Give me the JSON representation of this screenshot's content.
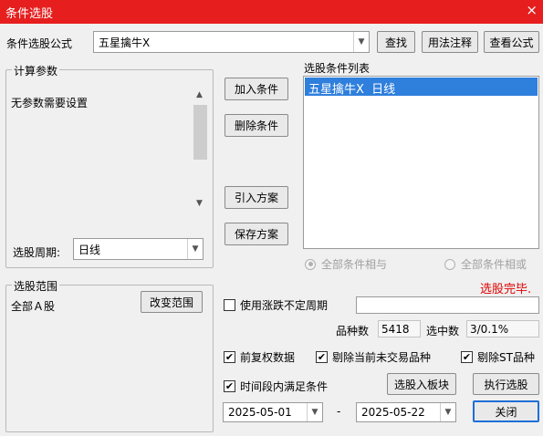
{
  "window": {
    "title": "条件选股",
    "close_glyph": "×"
  },
  "formula": {
    "label": "条件选股公式",
    "selected": "五星擒牛X",
    "find_button": "查找",
    "usage_button": "用法注释",
    "view_button": "查看公式"
  },
  "params": {
    "legend": "计算参数",
    "message": "无参数需要设置",
    "period_label": "选股周期:",
    "period_value": "日线"
  },
  "actions": {
    "add": "加入条件",
    "delete": "删除条件",
    "import": "引入方案",
    "save": "保存方案"
  },
  "conditions": {
    "label": "选股条件列表",
    "items": [
      "五星擒牛X  日线"
    ],
    "radio_and": "全部条件相与",
    "radio_or": "全部条件相或",
    "status": "选股完毕.",
    "status_color": "#e00000"
  },
  "range": {
    "legend": "选股范围",
    "value": "全部Ａ股",
    "change_button": "改变范围"
  },
  "options": {
    "variable_period": "使用涨跌不定周期",
    "variable_period_checked": false,
    "count_label": "品种数",
    "count_value": "5418",
    "hit_label": "选中数",
    "hit_value": "3/0.1%",
    "forward_adj": "前复权数据",
    "forward_adj_checked": true,
    "exclude_untraded": "剔除当前未交易品种",
    "exclude_untraded_checked": true,
    "exclude_st": "剔除ST品种",
    "exclude_st_checked": true,
    "time_range": "时间段内满足条件",
    "time_range_checked": true,
    "to_block_button": "选股入板块",
    "run_button": "执行选股",
    "start_date": "2025-05-01",
    "dash": "-",
    "end_date": "2025-05-22",
    "close_button": "关闭",
    "check_glyph": "✔"
  }
}
